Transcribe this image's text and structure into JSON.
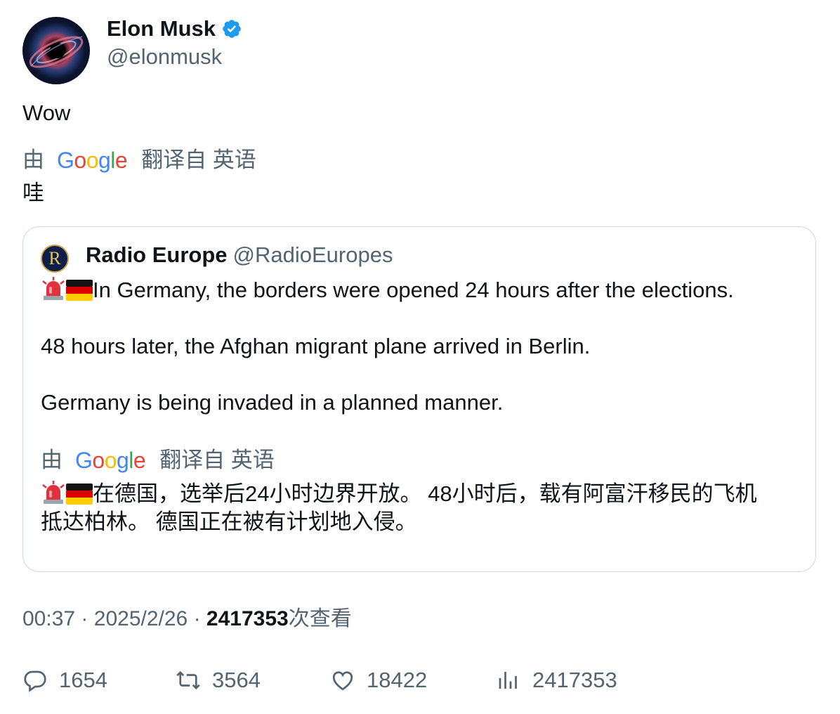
{
  "author": {
    "name": "Elon Musk",
    "handle": "@elonmusk"
  },
  "tweet": {
    "text": "Wow",
    "translation_prefix": "由",
    "translation_suffix": "翻译自 英语",
    "translated_text": "哇"
  },
  "quote": {
    "avatar_letter": "R",
    "name": "Radio Europe",
    "handle": "@RadioEuropes",
    "line1": "In Germany, the borders were opened 24 hours after the elections.",
    "line2": "48 hours later, the Afghan migrant plane arrived in Berlin.",
    "line3": "Germany is being invaded in a planned manner.",
    "translation_prefix": "由",
    "translation_suffix": "翻译自 英语",
    "translated_line1": "在德国，选举后24小时边界开放。 48小时后，载有阿富汗移民的飞机",
    "translated_line2": "抵达柏林。 德国正在被有计划地入侵。"
  },
  "meta": {
    "time": "00:37",
    "separator": "·",
    "date": "2025/2/26",
    "views_count": "2417353",
    "views_label": "次查看"
  },
  "actions": {
    "replies": "1654",
    "retweets": "3564",
    "likes": "18422",
    "views": "2417353"
  },
  "colors": {
    "secondary_text": "#536471",
    "verified_blue": "#1d9bf0",
    "border": "#cfd9de"
  }
}
